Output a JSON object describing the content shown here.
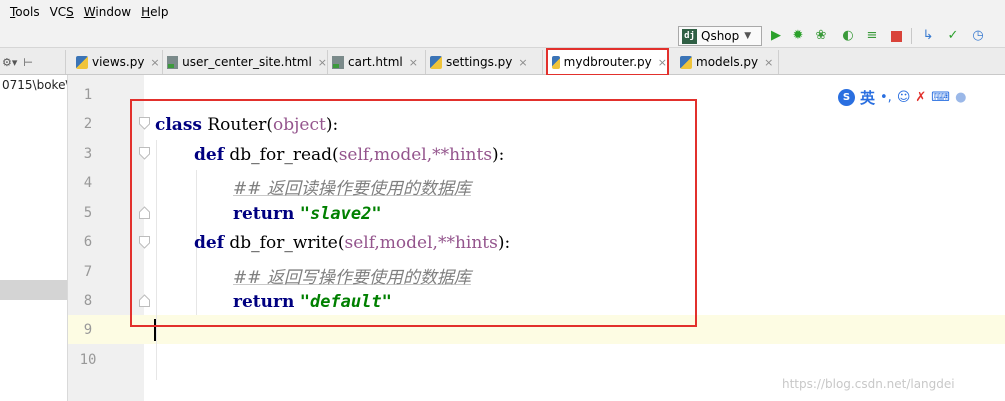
{
  "menu": {
    "tools": {
      "mnemonic": "T",
      "rest": "ools"
    },
    "vcs": {
      "pre": "VC",
      "mnemonic": "S"
    },
    "window": {
      "mnemonic": "W",
      "rest": "indow"
    },
    "help": {
      "mnemonic": "H",
      "rest": "elp"
    }
  },
  "toolbar": {
    "run_config_icon": "dj",
    "run_config": "Qshop",
    "icons": [
      "run-icon",
      "debug-icon",
      "coverage-icon",
      "profile-icon",
      "concurrency-icon",
      "stop-icon",
      "vcs-update-icon",
      "vcs-commit-icon",
      "vcs-history-icon"
    ]
  },
  "tabs": [
    {
      "label": "views.py",
      "icon": "python-file-icon",
      "active": false
    },
    {
      "label": "user_center_site.html",
      "icon": "html-file-icon",
      "active": false
    },
    {
      "label": "cart.html",
      "icon": "html-file-icon",
      "active": false
    },
    {
      "label": "settings.py",
      "icon": "python-file-icon",
      "active": false
    },
    {
      "label": "mydbrouter.py",
      "icon": "python-file-icon",
      "active": true
    },
    {
      "label": "models.py",
      "icon": "python-file-icon",
      "active": false
    }
  ],
  "tab_close_glyph": "×",
  "project": {
    "path": "0715\\boke\\"
  },
  "editor": {
    "line_numbers": [
      "1",
      "2",
      "3",
      "4",
      "5",
      "6",
      "7",
      "8",
      "9",
      "10"
    ],
    "current_line": 9,
    "lines": {
      "l2": {
        "kw": "class",
        "name": " Router(",
        "base": "object",
        "end": "):"
      },
      "l3": {
        "kw": "def",
        "name": " db_for_read(",
        "self": "self",
        "params": ",model,**hints",
        "end": "):"
      },
      "l4": {
        "comment": "## 返回读操作要使用的数据库"
      },
      "l5": {
        "kw": "return",
        "value": "\"slave2\""
      },
      "l6": {
        "kw": "def",
        "name": " db_for_write(",
        "self": "self",
        "params": ",model,**hints",
        "end": "):"
      },
      "l7": {
        "comment": "## 返回写操作要使用的数据库"
      },
      "l8": {
        "kw": "return",
        "value": "\"default\""
      }
    }
  },
  "ime": {
    "lang": "英",
    "icons": [
      "ime-logo-icon",
      "punctuation-icon",
      "emoji-icon",
      "tools-icon",
      "keyboard-icon",
      "user-icon"
    ]
  },
  "watermark": "https://blog.csdn.net/langdei",
  "colors": {
    "highlight": "#e2302c",
    "keyword": "#000080",
    "string": "#008000",
    "comment": "#808080",
    "self": "#94558d"
  }
}
